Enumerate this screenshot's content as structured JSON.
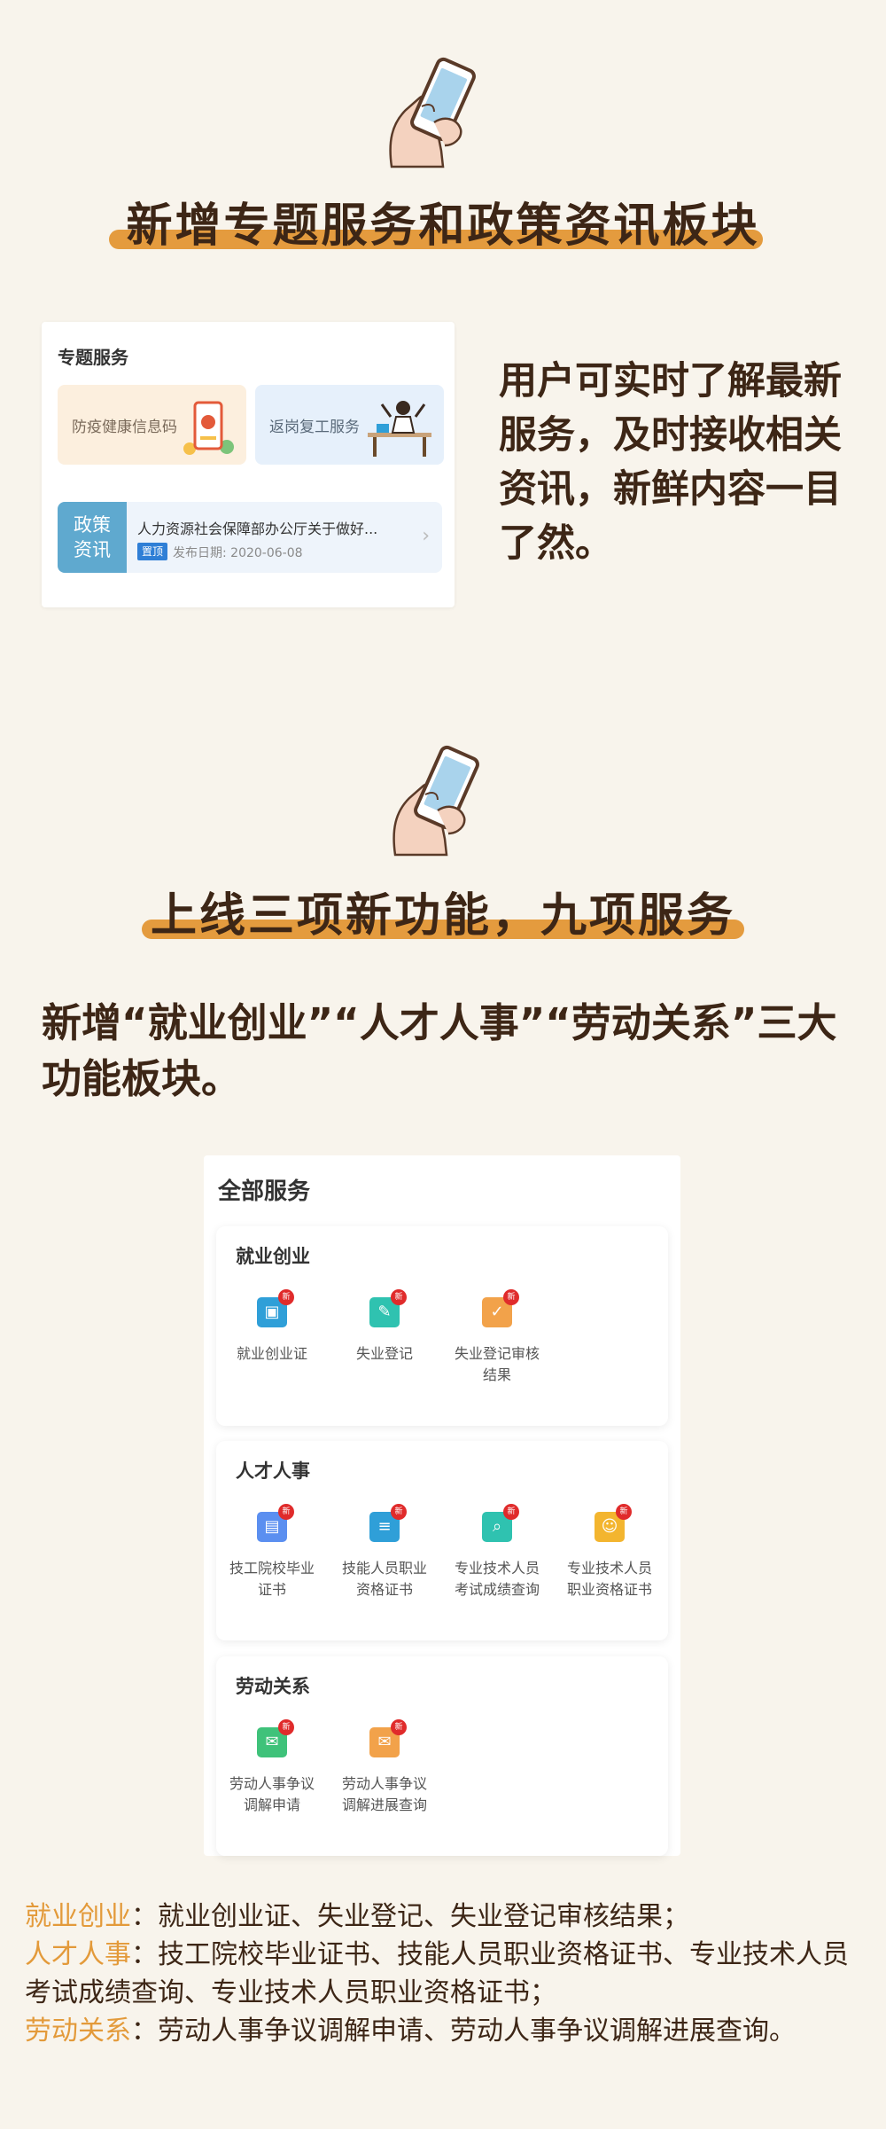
{
  "section1": {
    "title": "新增专题服务和政策资讯板块",
    "card": {
      "title": "专题服务",
      "tiles": [
        {
          "label": "防疫健康信息码"
        },
        {
          "label": "返岗复工服务"
        }
      ],
      "news": {
        "tag_line1": "政策",
        "tag_line2": "资讯",
        "headline": "人力资源社会保障部办公厅关于做好...",
        "badge": "置顶",
        "date": "发布日期: 2020-06-08"
      }
    },
    "description": "用户可实时了解最新服务，及时接收相关资讯，新鲜内容一目了然。"
  },
  "section2": {
    "title": "上线三项新功能，九项服务",
    "intro": "新增“就业创业”“人才人事”“劳动关系”三大功能板块。",
    "card": {
      "title": "全部服务",
      "new_badge": "新",
      "groups": [
        {
          "name": "就业创业",
          "items": [
            {
              "line1": "就业创业证",
              "line2": "",
              "color": "#2f9fd8",
              "icon": "id-card-icon"
            },
            {
              "line1": "失业登记",
              "line2": "",
              "color": "#2fc2b0",
              "icon": "register-icon"
            },
            {
              "line1": "失业登记审核",
              "line2": "结果",
              "color": "#f2a24a",
              "icon": "review-icon"
            }
          ]
        },
        {
          "name": "人才人事",
          "items": [
            {
              "line1": "技工院校毕业",
              "line2": "证书",
              "color": "#5b8ff0",
              "icon": "certificate-icon"
            },
            {
              "line1": "技能人员职业",
              "line2": "资格证书",
              "color": "#2f9fd8",
              "icon": "document-icon"
            },
            {
              "line1": "专业技术人员",
              "line2": "考试成绩查询",
              "color": "#2fc2b0",
              "icon": "score-query-icon"
            },
            {
              "line1": "专业技术人员",
              "line2": "职业资格证书",
              "color": "#f3b52f",
              "icon": "qualification-icon"
            }
          ]
        },
        {
          "name": "劳动关系",
          "items": [
            {
              "line1": "劳动人事争议",
              "line2": "调解申请",
              "color": "#3fc27a",
              "icon": "mediation-apply-icon"
            },
            {
              "line1": "劳动人事争议",
              "line2": "调解进展查询",
              "color": "#f2a24a",
              "icon": "mediation-progress-icon"
            }
          ]
        }
      ]
    }
  },
  "summary": [
    {
      "category": "就业创业",
      "text": "：就业创业证、失业登记、失业登记审核结果；"
    },
    {
      "category": "人才人事",
      "text": "：技工院校毕业证书、技能人员职业资格证书、专业技术人员考试成绩查询、专业技术人员职业资格证书；"
    },
    {
      "category": "劳动关系",
      "text": "：劳动人事争议调解申请、劳动人事争议调解进展查询。"
    }
  ],
  "colors": {
    "background": "#f8f4ec",
    "accent_bar": "#e49b3e",
    "category": "#e39a3a",
    "heading": "#3d2616"
  }
}
